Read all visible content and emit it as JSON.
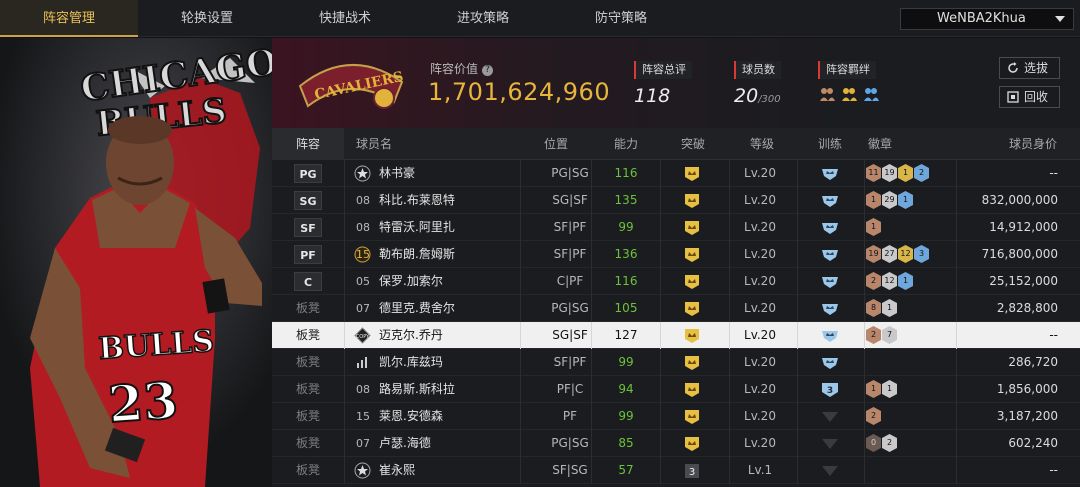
{
  "nav": {
    "tabs": [
      "阵容管理",
      "轮换设置",
      "快捷战术",
      "进攻策略",
      "防守策略"
    ],
    "active_index": 0,
    "account": "WeNBA2Khua"
  },
  "hero": {
    "logo_text": [
      "CHICAGO",
      "BULLS"
    ],
    "jersey_team": "BULLS",
    "jersey_number": "23"
  },
  "team": {
    "logo_text": "CAVALIERS",
    "value_label": "阵容价值",
    "value": "1,701,624,960",
    "rating_label": "阵容总评",
    "rating": "118",
    "players_label": "球员数",
    "players_count": "20",
    "players_max": "/300",
    "bonds_label": "阵容羁绊",
    "btn_select": "选拔",
    "btn_recall": "回收"
  },
  "table": {
    "headers": [
      "阵容",
      "球员名",
      "位置",
      "能力",
      "突破",
      "等级",
      "训练",
      "徽章",
      "球员身价"
    ],
    "rows": [
      {
        "slot": "PG",
        "bench": false,
        "num": "",
        "star": true,
        "name": "林书豪",
        "pos": "PG|SG",
        "ability": "116",
        "level": "Lv.20",
        "train": "on",
        "train_num": "",
        "badges": [
          {
            "t": "b",
            "n": "11"
          },
          {
            "t": "s",
            "n": "19"
          },
          {
            "t": "g",
            "n": "1"
          },
          {
            "t": "p",
            "n": "2"
          }
        ],
        "salary": "--",
        "sel": false
      },
      {
        "slot": "SG",
        "bench": false,
        "num": "08",
        "star": false,
        "name": "科比.布莱恩特",
        "pos": "SG|SF",
        "ability": "135",
        "level": "Lv.20",
        "train": "on",
        "train_num": "",
        "badges": [
          {
            "t": "b",
            "n": "1"
          },
          {
            "t": "s",
            "n": "29"
          },
          {
            "t": "p",
            "n": "1"
          }
        ],
        "salary": "832,000,000",
        "sel": false
      },
      {
        "slot": "SF",
        "bench": false,
        "num": "08",
        "star": false,
        "name": "特雷沃.阿里扎",
        "pos": "SF|PF",
        "ability": "99",
        "level": "Lv.20",
        "train": "on",
        "train_num": "",
        "badges": [
          {
            "t": "b",
            "n": "1"
          }
        ],
        "salary": "14,912,000",
        "sel": false
      },
      {
        "slot": "PF",
        "bench": false,
        "num": "15",
        "star": false,
        "gold": true,
        "name": "勒布朗.詹姆斯",
        "pos": "SF|PF",
        "ability": "136",
        "level": "Lv.20",
        "train": "on",
        "train_num": "",
        "badges": [
          {
            "t": "b",
            "n": "19"
          },
          {
            "t": "s",
            "n": "27"
          },
          {
            "t": "g",
            "n": "12"
          },
          {
            "t": "p",
            "n": "3"
          }
        ],
        "salary": "716,800,000",
        "sel": false
      },
      {
        "slot": "C",
        "bench": false,
        "num": "05",
        "star": false,
        "name": "保罗.加索尔",
        "pos": "C|PF",
        "ability": "116",
        "level": "Lv.20",
        "train": "on",
        "train_num": "",
        "badges": [
          {
            "t": "b",
            "n": "2"
          },
          {
            "t": "s",
            "n": "12"
          },
          {
            "t": "p",
            "n": "1"
          }
        ],
        "salary": "25,152,000",
        "sel": false
      },
      {
        "slot": "板凳",
        "bench": true,
        "num": "07",
        "star": false,
        "name": "德里克.费舍尔",
        "pos": "PG|SG",
        "ability": "105",
        "level": "Lv.20",
        "train": "on",
        "train_num": "",
        "badges": [
          {
            "t": "b",
            "n": "8"
          },
          {
            "t": "s",
            "n": "1"
          }
        ],
        "salary": "2,828,800",
        "sel": false
      },
      {
        "slot": "板凳",
        "bench": true,
        "num": "",
        "star": false,
        "copy": true,
        "name": "迈克尔.乔丹",
        "pos": "SG|SF",
        "ability": "127",
        "level": "Lv.20",
        "train": "on",
        "train_num": "",
        "badges": [
          {
            "t": "b",
            "n": "2"
          },
          {
            "t": "s",
            "n": "7"
          }
        ],
        "salary": "--",
        "sel": true
      },
      {
        "slot": "板凳",
        "bench": true,
        "num": "",
        "star": false,
        "bars": true,
        "name": "凯尔.库兹玛",
        "pos": "SF|PF",
        "ability": "99",
        "level": "Lv.20",
        "train": "on",
        "train_num": "",
        "badges": [],
        "salary": "286,720",
        "sel": false
      },
      {
        "slot": "板凳",
        "bench": true,
        "num": "08",
        "star": false,
        "name": "路易斯.斯科拉",
        "pos": "PF|C",
        "ability": "94",
        "level": "Lv.20",
        "train": "num",
        "train_num": "3",
        "badges": [
          {
            "t": "b",
            "n": "1"
          },
          {
            "t": "s",
            "n": "1"
          }
        ],
        "salary": "1,856,000",
        "sel": false
      },
      {
        "slot": "板凳",
        "bench": true,
        "num": "15",
        "star": false,
        "name": "莱恩.安德森",
        "pos": "PF",
        "ability": "99",
        "level": "Lv.20",
        "train": "off",
        "train_num": "",
        "badges": [
          {
            "t": "b",
            "n": "2"
          }
        ],
        "salary": "3,187,200",
        "sel": false
      },
      {
        "slot": "板凳",
        "bench": true,
        "num": "07",
        "star": false,
        "name": "卢瑟.海德",
        "pos": "PG|SG",
        "ability": "85",
        "level": "Lv.20",
        "train": "off",
        "train_num": "",
        "badges": [
          {
            "t": "d",
            "n": "0"
          },
          {
            "t": "s",
            "n": "2"
          }
        ],
        "salary": "602,240",
        "sel": false
      },
      {
        "slot": "板凳",
        "bench": true,
        "num": "",
        "star": true,
        "name": "崔永熙",
        "pos": "SF|SG",
        "ability": "57",
        "level": "Lv.1",
        "train": "off",
        "train_num": "",
        "brk_num": "3",
        "badges": [],
        "salary": "--",
        "sel": false
      }
    ]
  },
  "colors": {
    "accent_gold": "#e7b43c",
    "ability_green": "#6cc23a",
    "stat_red": "#d93a36"
  }
}
